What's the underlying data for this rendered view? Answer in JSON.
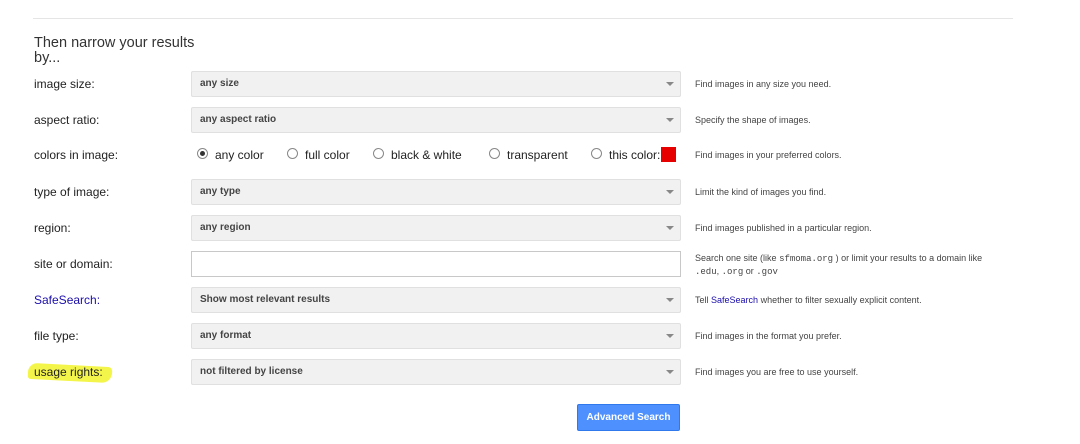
{
  "section": {
    "heading": "Then narrow your results by..."
  },
  "rows": {
    "image_size": {
      "label": "image size:",
      "value": "any size",
      "help": "Find images in any size you need."
    },
    "aspect_ratio": {
      "label": "aspect ratio:",
      "value": "any aspect ratio",
      "help": "Specify the shape of images."
    },
    "colors": {
      "label": "colors in image:",
      "options": [
        "any color",
        "full color",
        "black & white",
        "transparent",
        "this color:"
      ],
      "selected": "any color",
      "custom_color": "#e60000",
      "help": "Find images in your preferred colors."
    },
    "type": {
      "label": "type of image:",
      "value": "any type",
      "help": "Limit the kind of images you find."
    },
    "region": {
      "label": "region:",
      "value": "any region",
      "help": "Find images published in a particular region."
    },
    "site": {
      "label": "site or domain:",
      "value": "",
      "help_a": "Search one site (like",
      "help_example": "sfmoma.org",
      "help_b": ") or limit your results to a domain like",
      "help_d1": ".edu",
      "help_d2": ".org",
      "help_or": "or",
      "help_d3": ".gov"
    },
    "safesearch": {
      "label": "SafeSearch:",
      "value": "Show most relevant results",
      "help_a": "Tell",
      "help_link": "SafeSearch",
      "help_b": "whether to filter sexually explicit content."
    },
    "file_type": {
      "label": "file type:",
      "value": "any format",
      "help": "Find images in the format you prefer."
    },
    "usage": {
      "label": "usage rights:",
      "value": "not filtered by license",
      "help": "Find images you are free to use yourself."
    }
  },
  "button": {
    "label": "Advanced Search"
  },
  "colors": {
    "accent": "#4d90fe",
    "link": "#1a0dab",
    "highlight": "#f4f54a"
  }
}
